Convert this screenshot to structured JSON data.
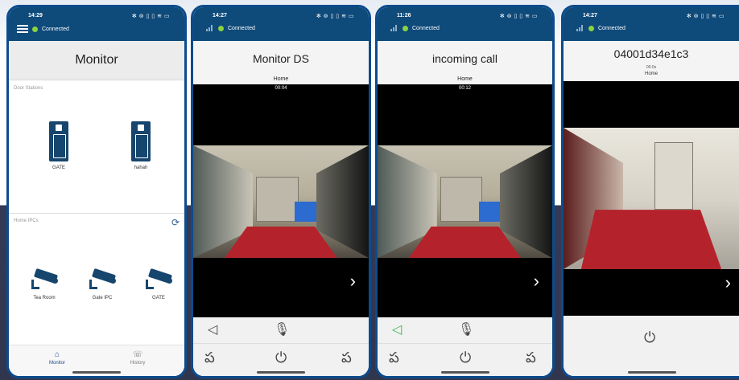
{
  "screen1": {
    "status": {
      "time": "14:29",
      "icons": "✻ ⊚ ▯ ▯ ≋ ▭",
      "connection": "Connected"
    },
    "title": "Monitor",
    "door_section_label": "Door Stations",
    "door_stations": [
      {
        "name": "GATE"
      },
      {
        "name": "hahah"
      }
    ],
    "ipc_section_label": "Home IPCs",
    "ipcs": [
      {
        "name": "Tea Room"
      },
      {
        "name": "Gate IPC"
      },
      {
        "name": "GATE"
      }
    ],
    "nav": [
      {
        "label": "Monitor",
        "icon": "monitor-icon",
        "active": true
      },
      {
        "label": "History",
        "icon": "history-icon",
        "active": false
      }
    ]
  },
  "screen2": {
    "status": {
      "time": "14:27",
      "icons": "✻ ⊚ ▯ ▯ ≋ ▭",
      "connection": "Connected"
    },
    "title": "Monitor DS",
    "subtitle": "Home",
    "timer": "00:04",
    "accent": "#0e4a7a"
  },
  "screen3": {
    "status": {
      "time": "11:26",
      "icons": "✻ ⊚ ▯ ▯ ≋ ▭",
      "connection": "Connected"
    },
    "title": "incoming call",
    "subtitle": "Home",
    "timer": "00:12",
    "speaker_color": "#39b54a"
  },
  "screen4": {
    "status": {
      "time": "14:27",
      "icons": "✻ ⊚ ▯ ▯ ≋ ▭",
      "connection": "Connected"
    },
    "title": "04001d34e1c3",
    "timer": "00:0s",
    "subtitle": "Home"
  },
  "glyphs": {
    "chevron": "›",
    "speaker": "◁",
    "mic": "🎙",
    "power": "⏻",
    "unlock": "ప",
    "refresh": "⟳",
    "nav_monitor": "⌂",
    "nav_history": "☏"
  }
}
